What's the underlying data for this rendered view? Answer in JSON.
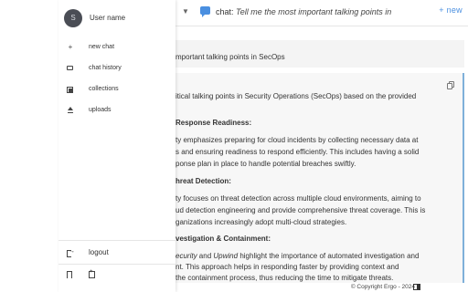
{
  "drawer": {
    "avatar_initial": "S",
    "user_name": "User name",
    "items": [
      {
        "label": "new chat",
        "icon": "plus-icon"
      },
      {
        "label": "chat history",
        "icon": "chat-history-icon"
      },
      {
        "label": "collections",
        "icon": "collections-icon"
      },
      {
        "label": "uploads",
        "icon": "upload-icon"
      }
    ],
    "logout_label": "logout",
    "bottom_icons": [
      "bookmark-icon",
      "bookmark-add-icon"
    ]
  },
  "topbar": {
    "chat_label": "chat:",
    "chat_title": "Tell me the most important talking points in",
    "new_label": "+ new",
    "accent": "#4a8fe0"
  },
  "user_message": "mportant talking points in SecOps",
  "answer": {
    "lines": [
      "itical talking points in Security Operations (SecOps) based on the provided",
      "Response Readiness:",
      "ty emphasizes preparing for cloud incidents by collecting necessary data at",
      "s and ensuring readiness to respond efficiently. This includes having a solid",
      "ponse plan in place to handle potential breaches swiftly.",
      "hreat Detection:",
      "ty focuses on threat detection across multiple cloud environments, aiming to",
      "ud detection engineering and provide comprehensive threat coverage. This is",
      "ganizations increasingly adopt multi-cloud strategies.",
      "vestigation & Containment:",
      "ecurity",
      "and",
      "Upwind",
      "highlight the importance of automated investigation and",
      "nt. This approach helps in responding faster by providing context and",
      "the containment process, thus reducing the time to mitigate threats."
    ]
  },
  "footer": {
    "copyright": "© Copyright Ergo - 2024"
  }
}
